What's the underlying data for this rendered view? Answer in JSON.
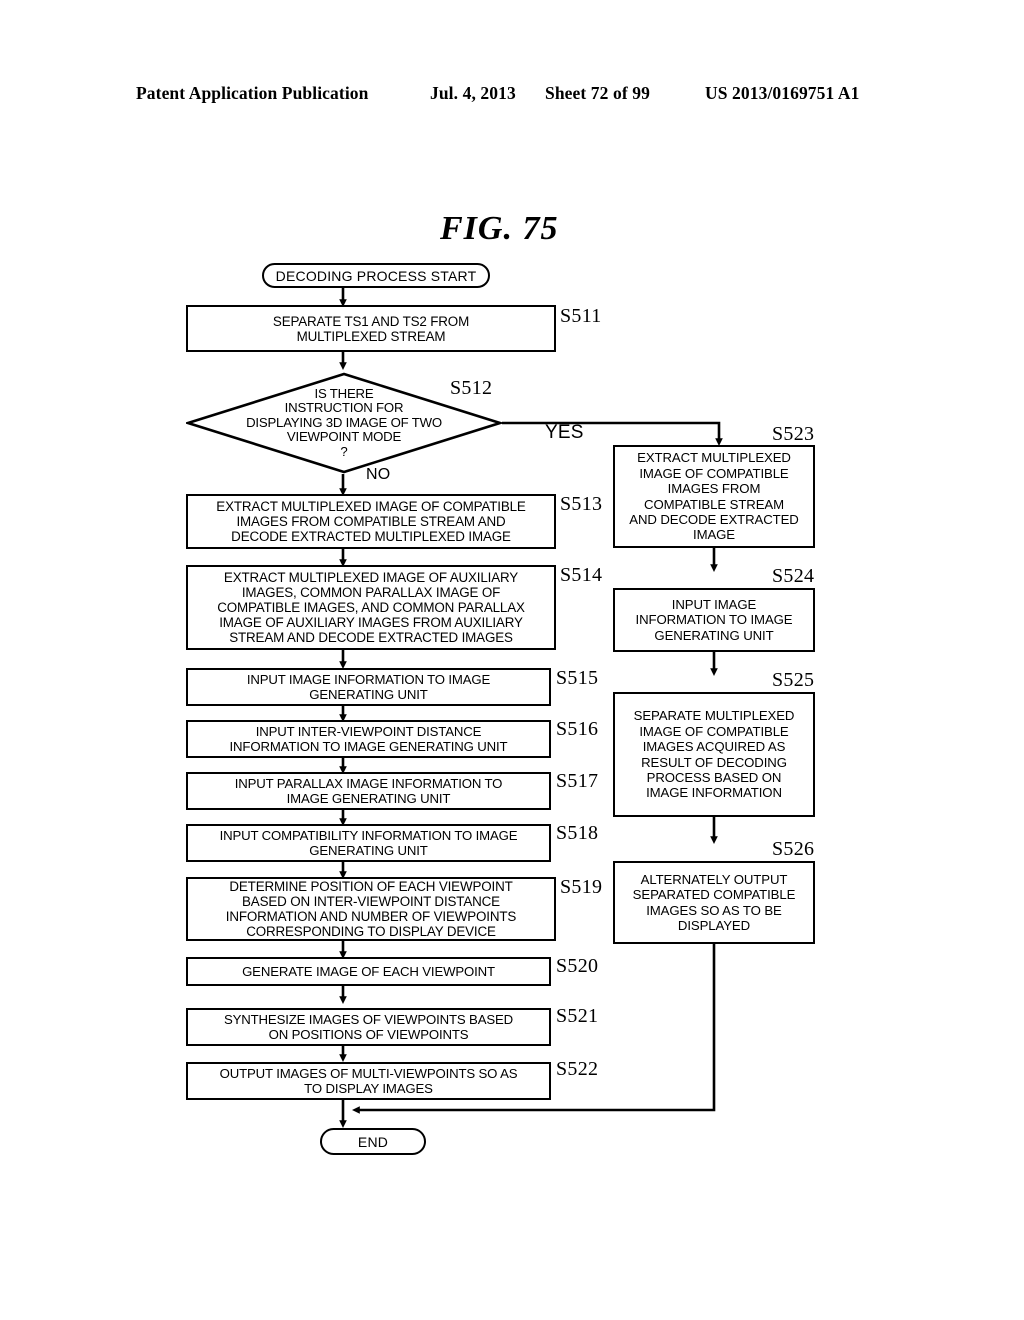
{
  "header": {
    "publication": "Patent Application Publication",
    "date": "Jul. 4, 2013",
    "sheet": "Sheet 72 of 99",
    "number": "US 2013/0169751 A1"
  },
  "figure": {
    "title": "FIG. 75"
  },
  "flowchart": {
    "start_label": "DECODING PROCESS START",
    "end_label": "END",
    "branch_yes": "YES",
    "branch_no": "NO",
    "decision": {
      "ref": "S512",
      "text": "IS THERE\nINSTRUCTION FOR\nDISPLAYING 3D IMAGE OF TWO\nVIEWPOINT MODE\n?"
    },
    "left_steps": [
      {
        "ref": "S511",
        "text": "SEPARATE TS1 AND TS2 FROM\nMULTIPLEXED STREAM"
      },
      {
        "ref": "S513",
        "text": "EXTRACT MULTIPLEXED IMAGE OF COMPATIBLE\nIMAGES FROM COMPATIBLE STREAM AND\nDECODE EXTRACTED MULTIPLEXED IMAGE"
      },
      {
        "ref": "S514",
        "text": "EXTRACT MULTIPLEXED IMAGE OF AUXILIARY\nIMAGES, COMMON PARALLAX IMAGE OF\nCOMPATIBLE IMAGES, AND COMMON PARALLAX\nIMAGE OF AUXILIARY IMAGES FROM AUXILIARY\nSTREAM AND DECODE EXTRACTED IMAGES"
      },
      {
        "ref": "S515",
        "text": "INPUT IMAGE INFORMATION TO IMAGE\nGENERATING UNIT"
      },
      {
        "ref": "S516",
        "text": "INPUT INTER-VIEWPOINT DISTANCE\nINFORMATION TO IMAGE GENERATING UNIT"
      },
      {
        "ref": "S517",
        "text": "INPUT PARALLAX IMAGE INFORMATION TO\nIMAGE GENERATING UNIT"
      },
      {
        "ref": "S518",
        "text": "INPUT COMPATIBILITY INFORMATION TO IMAGE\nGENERATING UNIT"
      },
      {
        "ref": "S519",
        "text": "DETERMINE POSITION OF EACH VIEWPOINT\nBASED ON INTER-VIEWPOINT DISTANCE\nINFORMATION AND NUMBER OF VIEWPOINTS\nCORRESPONDING TO DISPLAY DEVICE"
      },
      {
        "ref": "S520",
        "text": "GENERATE IMAGE OF EACH VIEWPOINT"
      },
      {
        "ref": "S521",
        "text": "SYNTHESIZE IMAGES OF VIEWPOINTS BASED\nON POSITIONS OF VIEWPOINTS"
      },
      {
        "ref": "S522",
        "text": "OUTPUT IMAGES OF MULTI-VIEWPOINTS SO AS\nTO DISPLAY IMAGES"
      }
    ],
    "right_steps": [
      {
        "ref": "S523",
        "text": "EXTRACT MULTIPLEXED\nIMAGE OF COMPATIBLE\nIMAGES FROM\nCOMPATIBLE STREAM\nAND DECODE EXTRACTED\nIMAGE"
      },
      {
        "ref": "S524",
        "text": "INPUT IMAGE\nINFORMATION TO IMAGE\nGENERATING UNIT"
      },
      {
        "ref": "S525",
        "text": "SEPARATE MULTIPLEXED\nIMAGE OF COMPATIBLE\nIMAGES ACQUIRED AS\nRESULT OF DECODING\nPROCESS BASED ON\nIMAGE INFORMATION"
      },
      {
        "ref": "S526",
        "text": "ALTERNATELY OUTPUT\nSEPARATED COMPATIBLE\nIMAGES SO AS TO BE\nDISPLAYED"
      }
    ]
  }
}
